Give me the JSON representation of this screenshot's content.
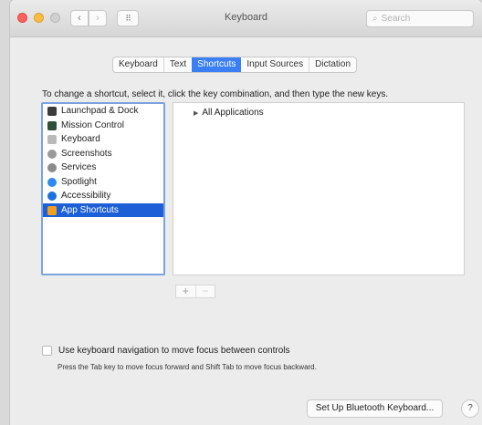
{
  "window": {
    "title": "Keyboard"
  },
  "toolbar": {
    "back_glyph": "‹",
    "forward_glyph": "›",
    "grid_glyph": "⠿",
    "search_placeholder": "Search",
    "search_glyph": "⌕"
  },
  "tabs": [
    {
      "label": "Keyboard",
      "selected": false
    },
    {
      "label": "Text",
      "selected": false
    },
    {
      "label": "Shortcuts",
      "selected": true
    },
    {
      "label": "Input Sources",
      "selected": false
    },
    {
      "label": "Dictation",
      "selected": false
    }
  ],
  "instructions": "To change a shortcut, select it, click the key combination, and then type the new keys.",
  "categories": [
    {
      "label": "Launchpad & Dock",
      "icon": "launchpad-icon",
      "color": "#3b3b3b"
    },
    {
      "label": "Mission Control",
      "icon": "mission-control-icon",
      "color": "#2f4f3a"
    },
    {
      "label": "Keyboard",
      "icon": "keyboard-icon",
      "color": "#b9b9b9"
    },
    {
      "label": "Screenshots",
      "icon": "screenshots-icon",
      "color": "#9a9a9a"
    },
    {
      "label": "Services",
      "icon": "gear-icon",
      "color": "#8c8c8c"
    },
    {
      "label": "Spotlight",
      "icon": "spotlight-icon",
      "color": "#2c8af0"
    },
    {
      "label": "Accessibility",
      "icon": "accessibility-icon",
      "color": "#1e6fe0"
    },
    {
      "label": "App Shortcuts",
      "icon": "app-shortcuts-icon",
      "color": "#f0a020",
      "selected": true
    }
  ],
  "shortcuts_tree": {
    "row_label": "All Applications",
    "expand_glyph": "▶"
  },
  "add_remove": {
    "add": "+",
    "remove": "−"
  },
  "keyboard_nav": {
    "label": "Use keyboard navigation to move focus between controls",
    "hint": "Press the Tab key to move focus forward and Shift Tab to move focus backward.",
    "checked": false
  },
  "footer": {
    "bluetooth_button": "Set Up Bluetooth Keyboard...",
    "help_button": "?"
  },
  "colors": {
    "accent": "#3a7ff7",
    "selection": "#1d5fd6"
  }
}
